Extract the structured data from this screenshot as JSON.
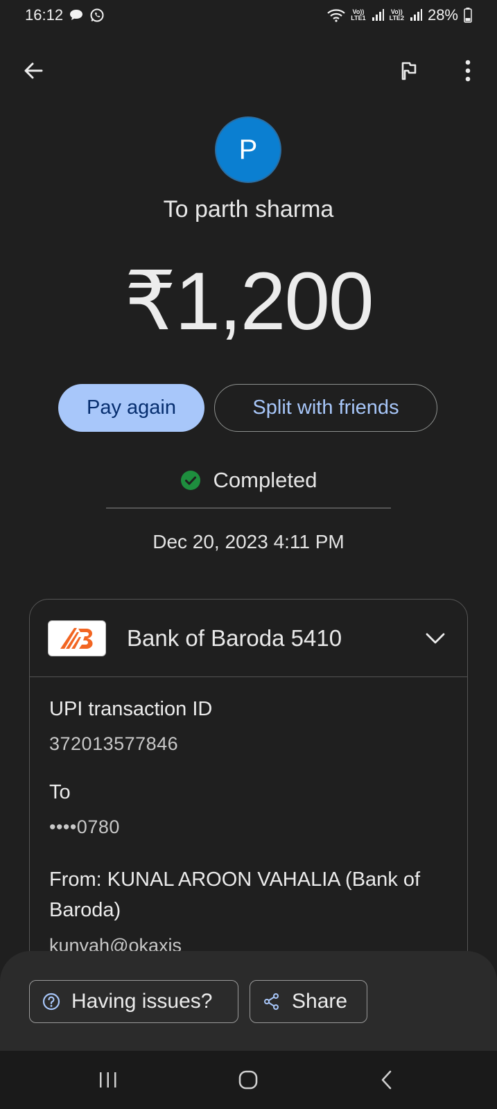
{
  "status_bar": {
    "time": "16:12",
    "net1_top": "Vo))",
    "net1_bottom": "LTE1",
    "net2_top": "Vo))",
    "net2_bottom": "LTE2",
    "battery": "28%"
  },
  "header": {
    "back_icon": "arrow-left-icon",
    "flag_icon": "flag-icon",
    "more_icon": "more-vert-icon"
  },
  "recipient": {
    "initial": "P",
    "label": "To parth sharma",
    "avatar_color": "#0b7fd1"
  },
  "amount": "₹1,200",
  "actions": {
    "pay_again": "Pay again",
    "split": "Split with friends"
  },
  "status": {
    "label": "Completed",
    "color": "#1e8e3e"
  },
  "datetime": "Dec 20, 2023 4:11 PM",
  "card": {
    "bank_name": "Bank of Baroda 5410",
    "bank_color": "#f26522",
    "fields": [
      {
        "label": "UPI transaction ID",
        "value": "372013577846"
      },
      {
        "label": "To",
        "value": "••••0780"
      }
    ],
    "from_label": "From: KUNAL AROON VAHALIA (Bank of Baroda)",
    "from_sub": "kunvah@okaxis"
  },
  "bottom_sheet": {
    "issues": "Having issues?",
    "share": "Share"
  }
}
